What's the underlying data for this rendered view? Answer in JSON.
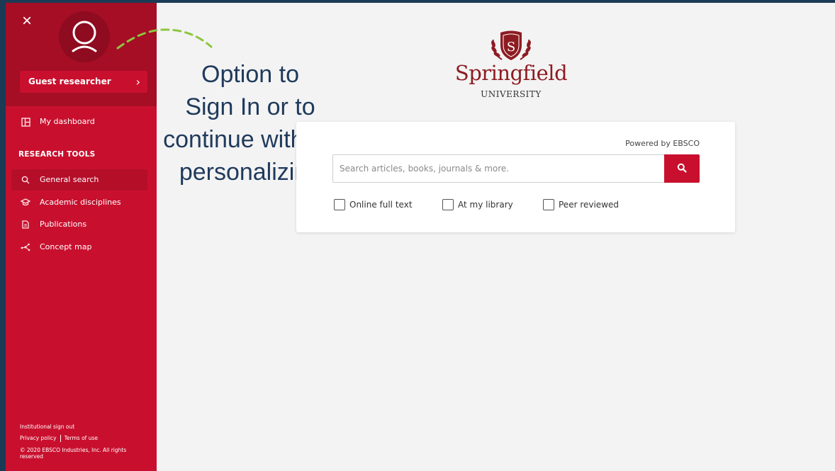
{
  "sidebar": {
    "close_glyph": "×",
    "guest_label": "Guest researcher",
    "guest_chevron": "›",
    "dashboard": {
      "label": "My dashboard",
      "icon": "dashboard-icon"
    },
    "section_title": "RESEARCH TOOLS",
    "items": [
      {
        "label": "General search",
        "icon": "search-icon",
        "active": true
      },
      {
        "label": "Academic disciplines",
        "icon": "mortarboard-icon",
        "active": false
      },
      {
        "label": "Publications",
        "icon": "document-icon",
        "active": false
      },
      {
        "label": "Concept map",
        "icon": "concept-map-icon",
        "active": false
      }
    ],
    "footer": {
      "signout": "Institutional sign out",
      "privacy": "Privacy policy",
      "terms": "Terms of use",
      "copyright": "© 2020 EBSCO Industries, Inc. All rights reserved"
    }
  },
  "annotation": {
    "lines": [
      "Option to",
      "Sign In or to",
      "continue without",
      "personalizing"
    ]
  },
  "logo": {
    "shield_letter": "S",
    "name": "Springfield",
    "sub": "UNIVERSITY"
  },
  "search": {
    "powered": "Powered by EBSCO",
    "placeholder": "Search articles, books, journals & more.",
    "value": "",
    "filters": [
      "Online full text",
      "At my library",
      "Peer reviewed"
    ]
  },
  "colors": {
    "brand_red": "#c8102e",
    "sidebar_dark": "#a50e25",
    "logo_red": "#8d1c22",
    "annotation_blue": "#1f3a5c",
    "arrow_green": "#8cc63f"
  }
}
